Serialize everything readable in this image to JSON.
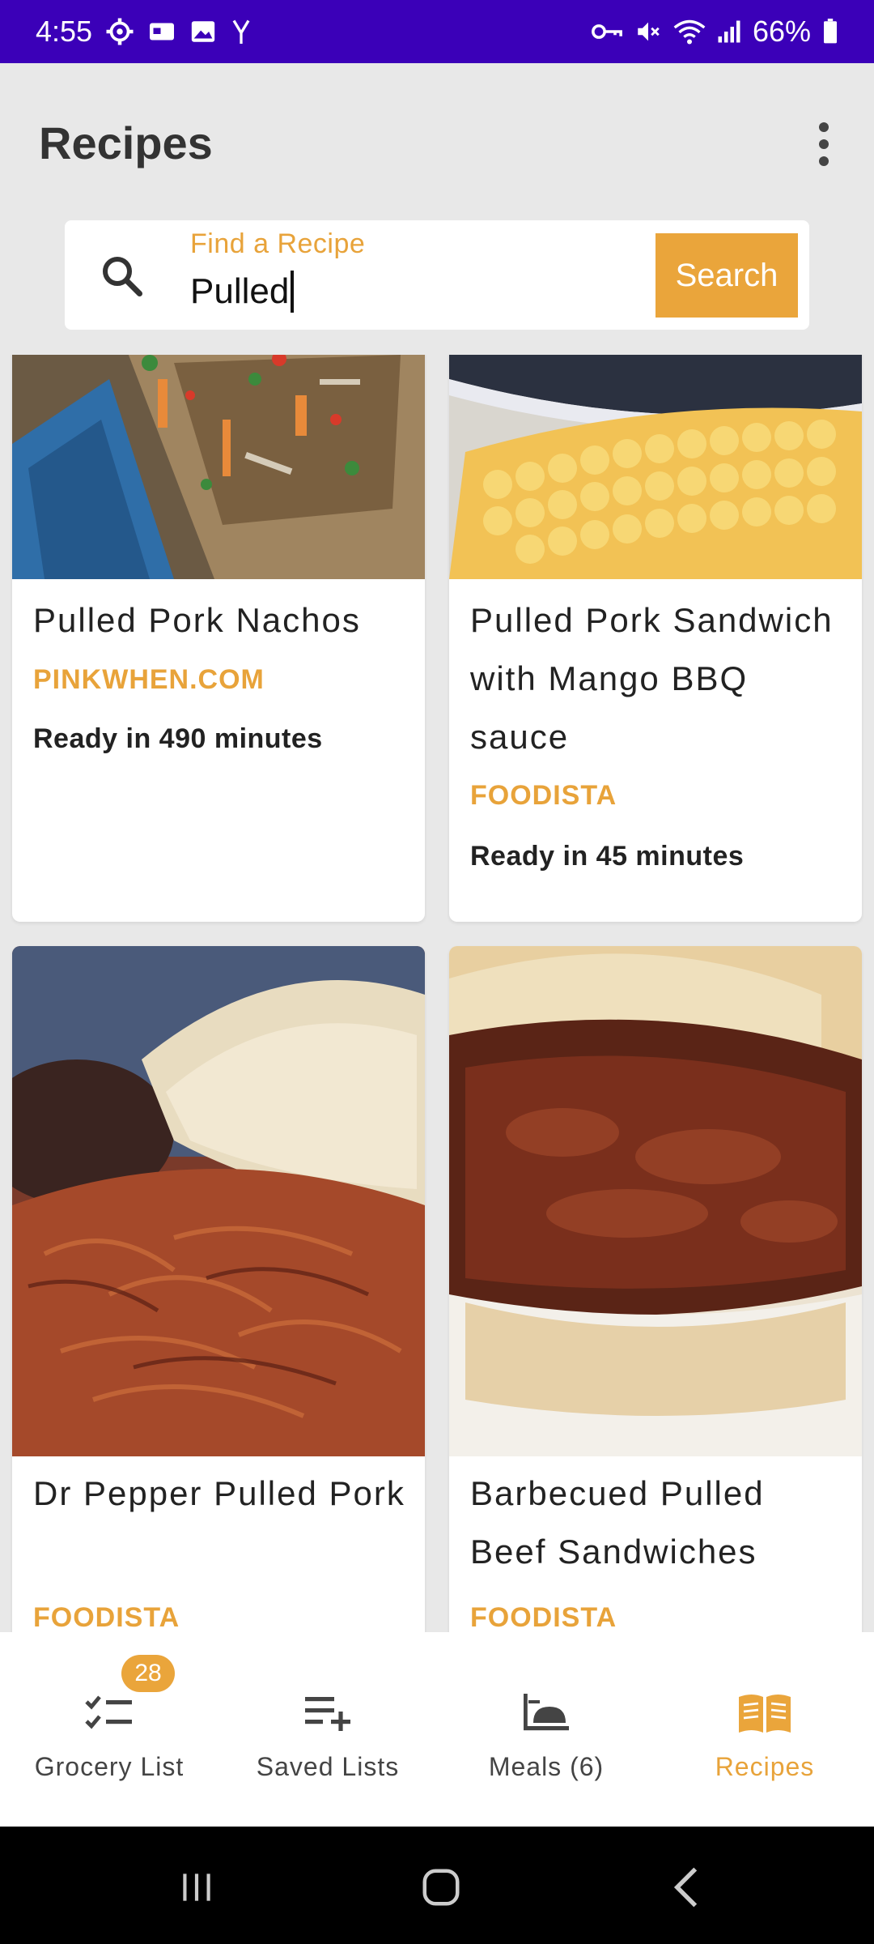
{
  "status_bar": {
    "time": "4:55",
    "battery": "66%",
    "left_icons": [
      "gear-icon",
      "key-card-icon",
      "image-icon",
      "signal-y-icon"
    ],
    "right_icons": [
      "vpn-key-icon",
      "mute-icon",
      "wifi-icon",
      "cell-signal-icon",
      "battery-icon"
    ]
  },
  "app_bar": {
    "title": "Recipes",
    "menu_icon": "more-vert-icon"
  },
  "search": {
    "label": "Find a Recipe",
    "value": "Pulled",
    "button_label": "Search"
  },
  "recipes": [
    {
      "title": "Pulled Pork Nachos",
      "source": "PINKWHEN.COM",
      "ready": "Ready in 490 minutes"
    },
    {
      "title": "Pulled Pork Sandwich with Mango BBQ sauce",
      "source": "FOODISTA",
      "ready": "Ready in 45 minutes"
    },
    {
      "title": "Dr Pepper Pulled Pork",
      "source": "FOODISTA"
    },
    {
      "title": "Barbecued Pulled Beef Sandwiches",
      "source": "FOODISTA"
    }
  ],
  "bottom_nav": {
    "items": [
      {
        "label": "Grocery List",
        "icon": "checklist-icon",
        "badge": "28"
      },
      {
        "label": "Saved Lists",
        "icon": "playlist-add-icon"
      },
      {
        "label": "Meals (6)",
        "icon": "dining-icon"
      },
      {
        "label": "Recipes",
        "icon": "book-icon",
        "active": true
      }
    ]
  },
  "colors": {
    "status_bar": "#3b00b8",
    "accent": "#eaa53b",
    "background": "#e8e8e8"
  }
}
